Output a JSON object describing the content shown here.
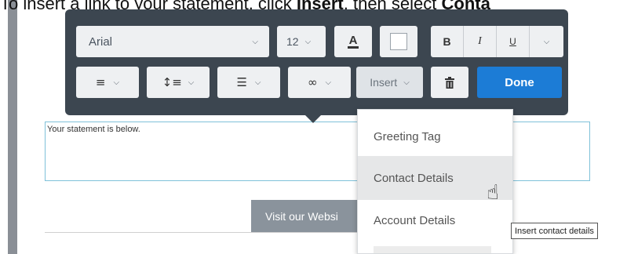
{
  "instruction": {
    "prefix": "To insert a link to your statement, click ",
    "insert_word": "Insert",
    "middle": ", then select ",
    "select_word": "Conta"
  },
  "toolbar": {
    "font_family": "Arial",
    "font_size": "12",
    "text_color_glyph": "A",
    "bold": "B",
    "italic": "I",
    "underline": "U",
    "insert_label": "Insert",
    "done_label": "Done"
  },
  "editor": {
    "statement_text": "Your statement is below."
  },
  "button": {
    "visit_label": "Visit our Websi"
  },
  "insert_menu": {
    "items": [
      "Greeting Tag",
      "Contact Details",
      "Account Details"
    ],
    "hovered_index": 1
  },
  "tooltip": {
    "text": "Insert contact details"
  },
  "icons": {
    "chevron": "chevron-down-icon",
    "align": "align-left-icon",
    "line_spacing": "line-spacing-icon",
    "list": "list-icon",
    "link": "link-icon",
    "trash": "trash-icon",
    "cursor": "hand-pointer-icon"
  },
  "colors": {
    "toolbar_bg": "#3c4650",
    "done_bg": "#1c7cd6",
    "editor_border": "#7fc1d9",
    "visit_btn_bg": "#8a939c"
  }
}
